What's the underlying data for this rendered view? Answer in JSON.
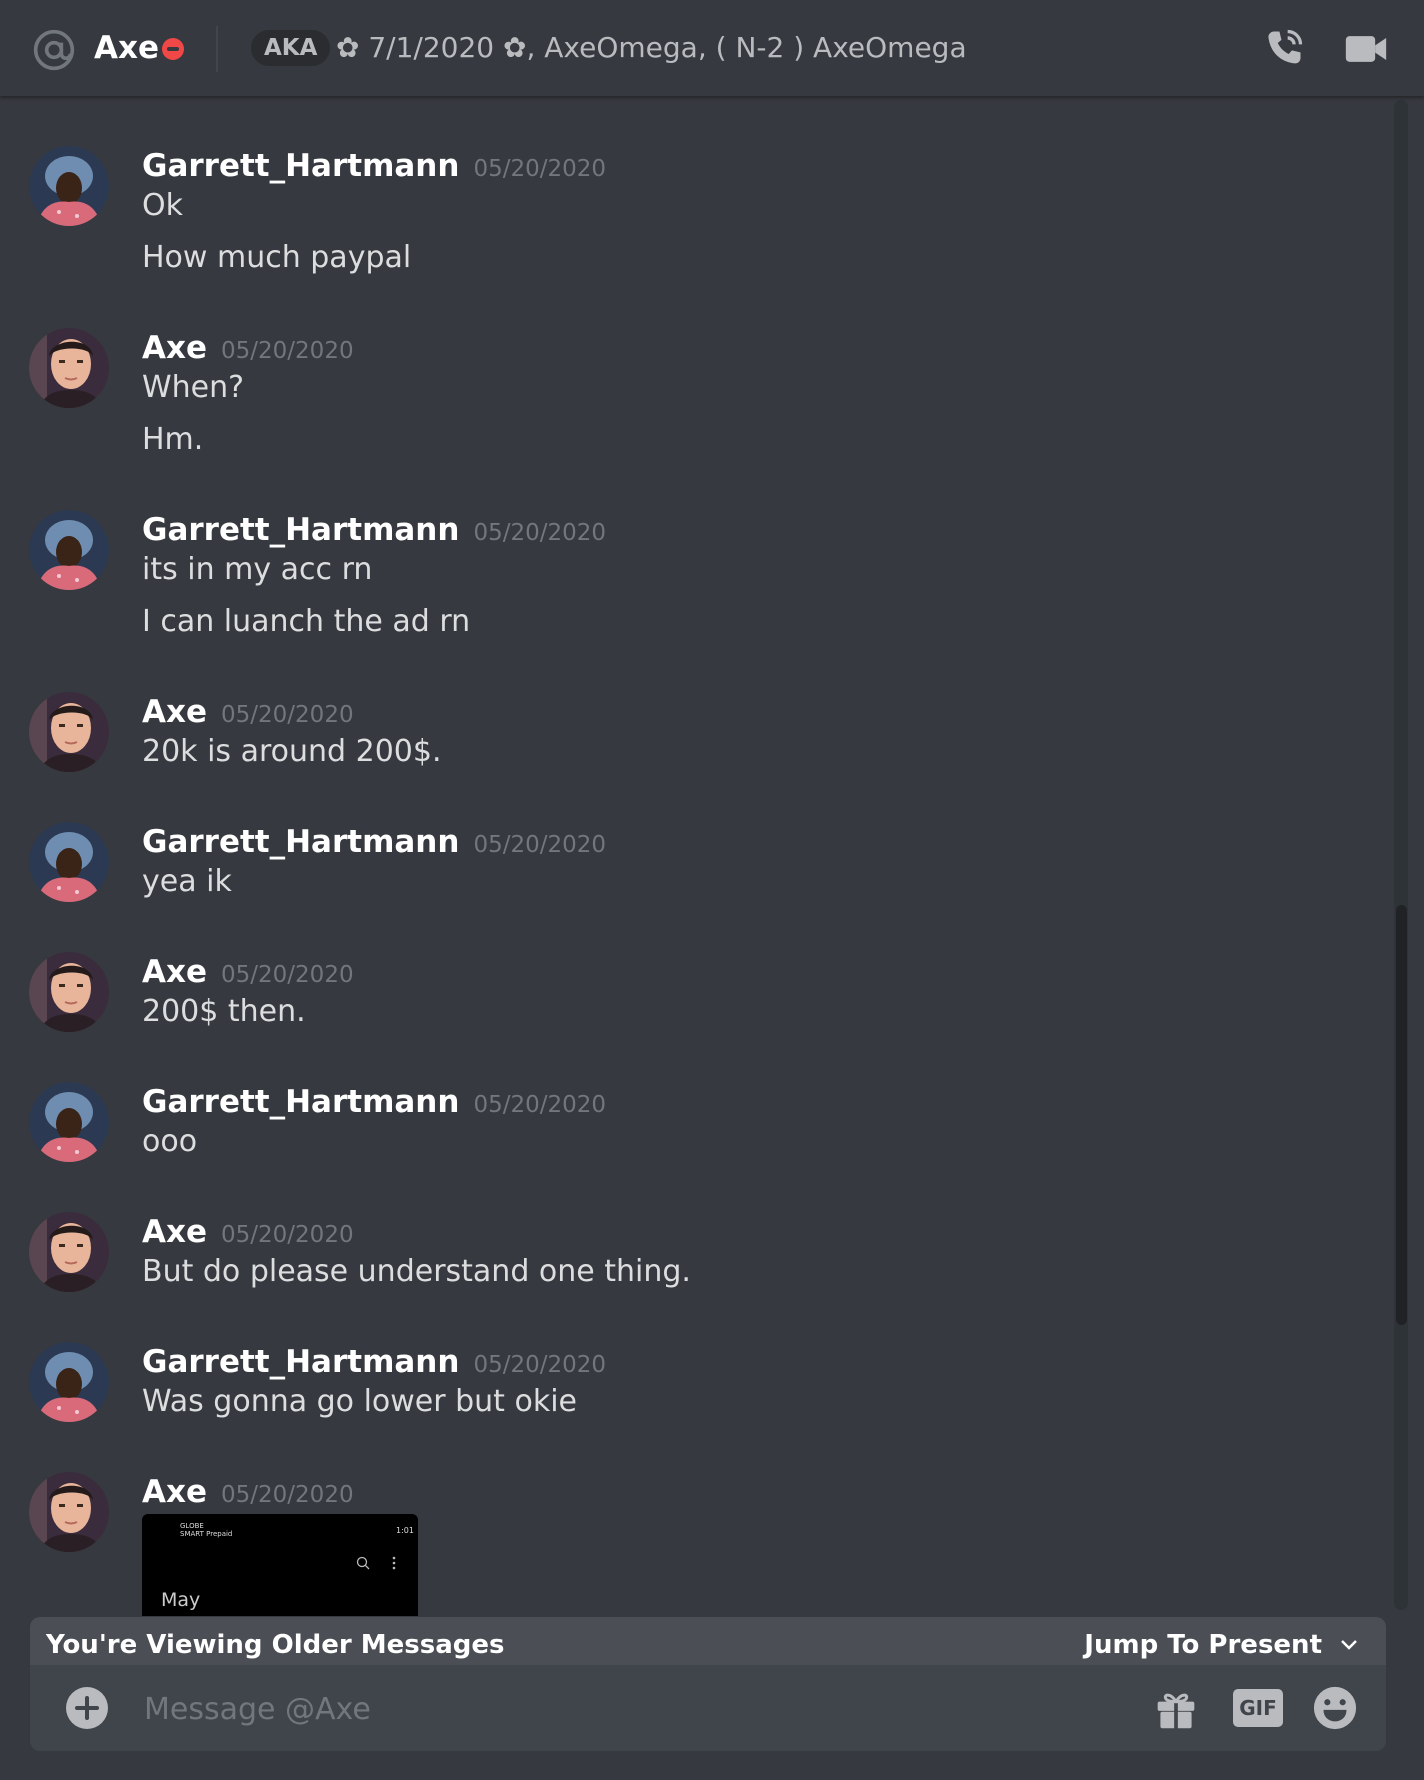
{
  "header": {
    "username": "Axe",
    "aka_label": "AKA",
    "aka_names": "✿ 7/1/2020 ✿, AxeOmega, ( N-2 ) AxeOmega"
  },
  "messages": [
    {
      "author": "Garrett_Hartmann",
      "timestamp": "05/20/2020",
      "avatar": "garrett",
      "lines": [
        "Ok",
        "How much paypal"
      ]
    },
    {
      "author": "Axe",
      "timestamp": "05/20/2020",
      "avatar": "axe",
      "lines": [
        "When?",
        "Hm."
      ]
    },
    {
      "author": "Garrett_Hartmann",
      "timestamp": "05/20/2020",
      "avatar": "garrett",
      "lines": [
        "its in my acc rn",
        "I can luanch the ad rn"
      ]
    },
    {
      "author": "Axe",
      "timestamp": "05/20/2020",
      "avatar": "axe",
      "lines": [
        "20k is around 200$."
      ]
    },
    {
      "author": "Garrett_Hartmann",
      "timestamp": "05/20/2020",
      "avatar": "garrett",
      "lines": [
        "yea ik"
      ]
    },
    {
      "author": "Axe",
      "timestamp": "05/20/2020",
      "avatar": "axe",
      "lines": [
        "200$ then."
      ]
    },
    {
      "author": "Garrett_Hartmann",
      "timestamp": "05/20/2020",
      "avatar": "garrett",
      "lines": [
        "ooo"
      ]
    },
    {
      "author": "Axe",
      "timestamp": "05/20/2020",
      "avatar": "axe",
      "lines": [
        "But do please understand one thing."
      ]
    },
    {
      "author": "Garrett_Hartmann",
      "timestamp": "05/20/2020",
      "avatar": "garrett",
      "lines": [
        "Was gonna go lower but okie"
      ]
    },
    {
      "author": "Axe",
      "timestamp": "05/20/2020",
      "avatar": "axe",
      "lines": [],
      "attachment": {
        "carrier": "GLOBE",
        "carrier_sub": "SMART Prepaid",
        "time": "1:01",
        "month": "May"
      }
    }
  ],
  "older_bar": {
    "text": "You're Viewing Older Messages",
    "jump_label": "Jump To Present"
  },
  "composer": {
    "placeholder": "Message @Axe",
    "gif_label": "GIF"
  },
  "colors": {
    "background": "#36393f",
    "dnd_status": "#f04747",
    "older_bar": "#4b4e55",
    "composer": "#40444b"
  },
  "icons": [
    "at-icon",
    "dnd-status-icon",
    "call-icon",
    "video-icon",
    "chevron-down-icon",
    "plus-icon",
    "gift-icon",
    "emoji-icon"
  ]
}
